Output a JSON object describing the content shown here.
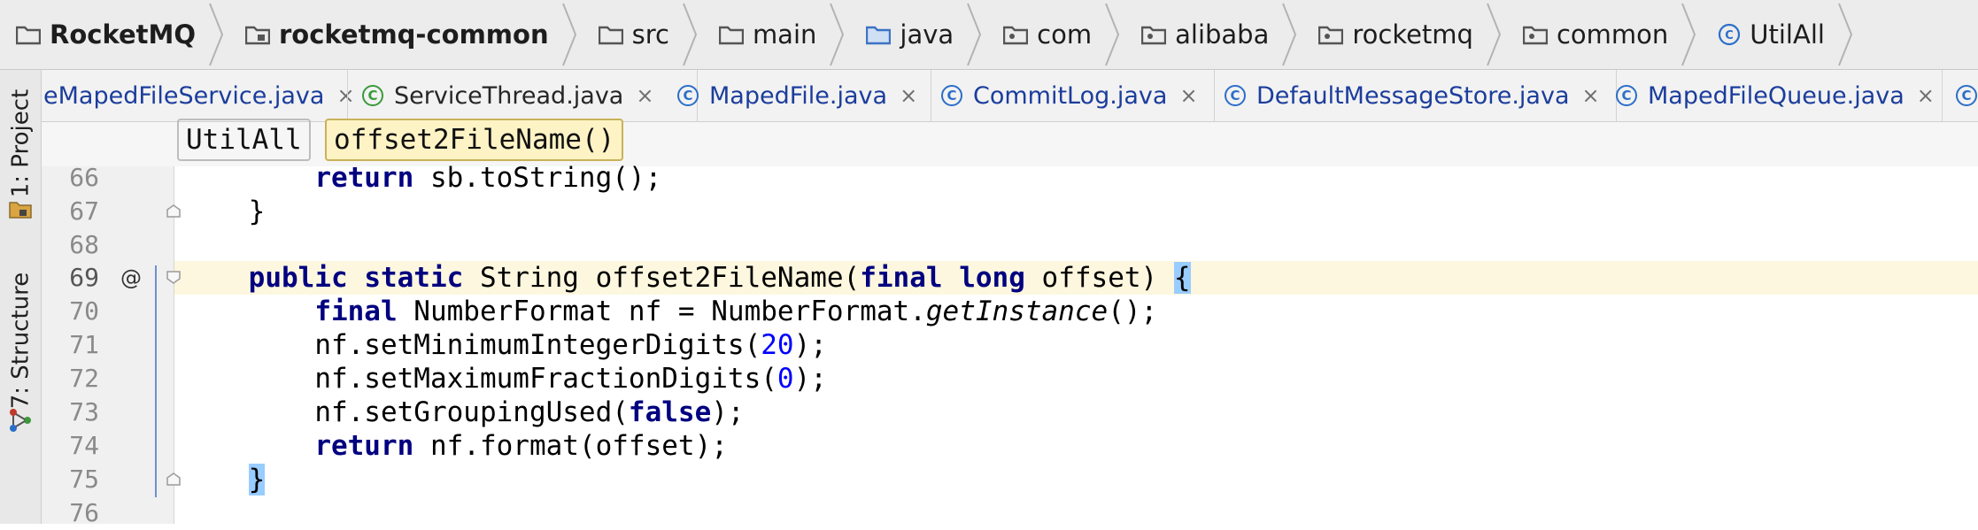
{
  "breadcrumb": {
    "items": [
      {
        "label": "RocketMQ",
        "icon": "folder-icon",
        "bold": true
      },
      {
        "label": "rocketmq-common",
        "icon": "module-folder-icon",
        "bold": true
      },
      {
        "label": "src",
        "icon": "folder-icon"
      },
      {
        "label": "main",
        "icon": "folder-icon"
      },
      {
        "label": "java",
        "icon": "source-folder-icon"
      },
      {
        "label": "com",
        "icon": "package-icon"
      },
      {
        "label": "alibaba",
        "icon": "package-icon"
      },
      {
        "label": "rocketmq",
        "icon": "package-icon"
      },
      {
        "label": "common",
        "icon": "package-icon"
      },
      {
        "label": "UtilAll",
        "icon": "class-icon"
      }
    ]
  },
  "tool_window_strip": {
    "project_tab": "1: Project",
    "structure_tab": "7: Structure"
  },
  "tabs": [
    {
      "label": "eMapedFileService.java",
      "close": "×"
    },
    {
      "label": "ServiceThread.java",
      "close": "×"
    },
    {
      "label": "MapedFile.java",
      "close": "×"
    },
    {
      "label": "CommitLog.java",
      "close": "×"
    },
    {
      "label": "DefaultMessageStore.java",
      "close": "×"
    },
    {
      "label": "MapedFileQueue.java",
      "close": "×"
    }
  ],
  "editor_breadcrumb": {
    "class_name": "UtilAll",
    "method_name": "offset2FileName()"
  },
  "gutter": {
    "line_numbers": [
      "66",
      "67",
      "68",
      "69",
      "70",
      "71",
      "72",
      "73",
      "74",
      "75",
      "76"
    ],
    "override_marker": "@"
  },
  "code": {
    "l66_kw": "return",
    "l66_rest": " sb.toString();",
    "l67": "}",
    "l69_kw1": "public",
    "l69_kw2": "static",
    "l69_mid": " String offset2FileName(",
    "l69_kw3": "final",
    "l69_kw4": "long",
    "l69_end": " offset) ",
    "l69_brace": "{",
    "l70_kw": "final",
    "l70_a": " NumberFormat nf = NumberFormat.",
    "l70_it": "getInstance",
    "l70_b": "();",
    "l71_a": "nf.setMinimumIntegerDigits(",
    "l71_num": "20",
    "l71_b": ");",
    "l72_a": "nf.setMaximumFractionDigits(",
    "l72_num": "0",
    "l72_b": ");",
    "l73_a": "nf.setGroupingUsed(",
    "l73_kw": "false",
    "l73_b": ");",
    "l74_kw": "return",
    "l74_rest": " nf.format(offset);",
    "l75": "}"
  },
  "colors": {
    "keyword": "#000080",
    "number": "#0000ff",
    "tab_label": "#1b3d9c",
    "current_line": "#fcf7de",
    "brace_highlight": "#99ccff"
  }
}
